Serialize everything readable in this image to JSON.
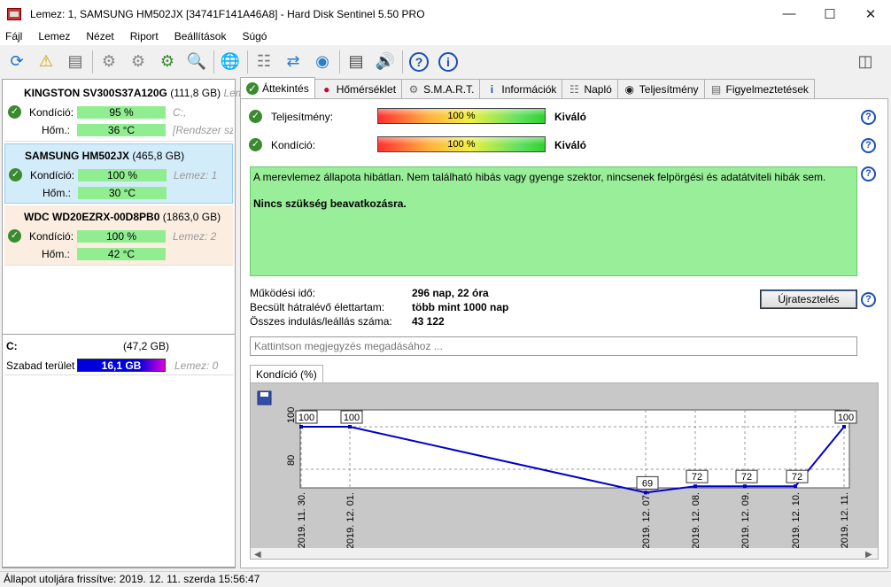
{
  "window": {
    "title": "Lemez: 1, SAMSUNG HM502JX [34741F141A46A8]  -  Hard Disk Sentinel 5.50 PRO"
  },
  "menu": [
    "Fájl",
    "Lemez",
    "Nézet",
    "Riport",
    "Beállítások",
    "Súgó"
  ],
  "disks": [
    {
      "name": "KINGSTON SV300S37A120G",
      "size": "(111,8 GB)",
      "extra_name": "Lem",
      "condition_label": "Kondíció:",
      "condition": "95 %",
      "condition_extra": "C:,",
      "temp_label": "Hőm.:",
      "temp": "36 °C",
      "temp_extra": "[Rendszer szá",
      "bg": "#ffffff"
    },
    {
      "name": "SAMSUNG HM502JX",
      "size": "(465,8 GB)",
      "extra_name": "",
      "condition_label": "Kondíció:",
      "condition": "100 %",
      "condition_extra": "Lemez: 1",
      "temp_label": "Hőm.:",
      "temp": "30 °C",
      "temp_extra": "",
      "bg": "#d3ecfa"
    },
    {
      "name": "WDC WD20EZRX-00D8PB0",
      "size": "(1863,0 GB)",
      "extra_name": "",
      "condition_label": "Kondíció:",
      "condition": "100 %",
      "condition_extra": "Lemez: 2",
      "temp_label": "Hőm.:",
      "temp": "42 °C",
      "temp_extra": "",
      "bg": "#fbeee0"
    }
  ],
  "volume": {
    "name": "C:",
    "size": "(47,2 GB)",
    "free_label": "Szabad terület",
    "free": "16,1 GB",
    "disk": "Lemez: 0"
  },
  "tabs": [
    "Áttekintés",
    "Hőmérséklet",
    "S.M.A.R.T.",
    "Információk",
    "Napló",
    "Teljesítmény",
    "Figyelmeztetések"
  ],
  "overview": {
    "perf_label": "Teljesítmény:",
    "perf_value": "100 %",
    "perf_text": "Kiváló",
    "cond_label": "Kondíció:",
    "cond_value": "100 %",
    "cond_text": "Kiváló",
    "message": "A merevlemez állapota hibátlan. Nem található hibás vagy gyenge szektor, nincsenek felpörgési és adatátviteli hibák sem.",
    "action": "Nincs szükség beavatkozásra.",
    "stats": [
      {
        "label": "Működési idő:",
        "value": "296 nap, 22 óra"
      },
      {
        "label": "Becsült hátralévő élettartam:",
        "value": "több mint 1000 nap"
      },
      {
        "label": "Összes indulás/leállás száma:",
        "value": "43 122"
      }
    ],
    "retest_button": "Újratesztelés",
    "comment_placeholder": "Kattintson megjegyzés megadásához ...",
    "chart_tab": "Kondíció  (%)"
  },
  "chart_data": {
    "type": "line",
    "x": [
      "2019. 11. 30.",
      "2019. 12. 01.",
      "2019. 12. 07.",
      "2019. 12. 08.",
      "2019. 12. 09.",
      "2019. 12. 10.",
      "2019. 12. 11."
    ],
    "series": [
      {
        "values": [
          100,
          100,
          69,
          72,
          72,
          72,
          100
        ]
      }
    ],
    "ylim": [
      60,
      100
    ],
    "yticks": [
      80,
      100
    ],
    "color": "#0000cc"
  },
  "status": "Állapot utoljára frissítve: 2019. 12. 11. szerda 15:56:47"
}
